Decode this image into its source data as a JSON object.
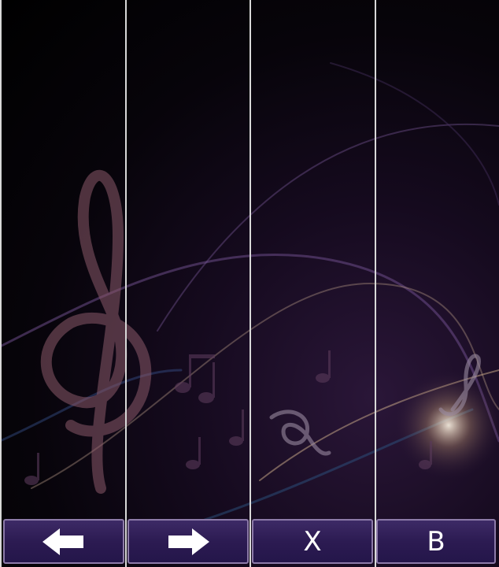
{
  "colors": {
    "button_fill": "#2c1b52",
    "button_border": "#8c7aa8",
    "lane_divider": "#d8d8d8",
    "background": "#07040a"
  },
  "background_art": {
    "description_icon": "music-notes-treble-clef-icon"
  },
  "controls": {
    "left": {
      "icon": "arrow-left-icon"
    },
    "right": {
      "icon": "arrow-right-icon"
    },
    "x_label": "X",
    "b_label": "B"
  }
}
